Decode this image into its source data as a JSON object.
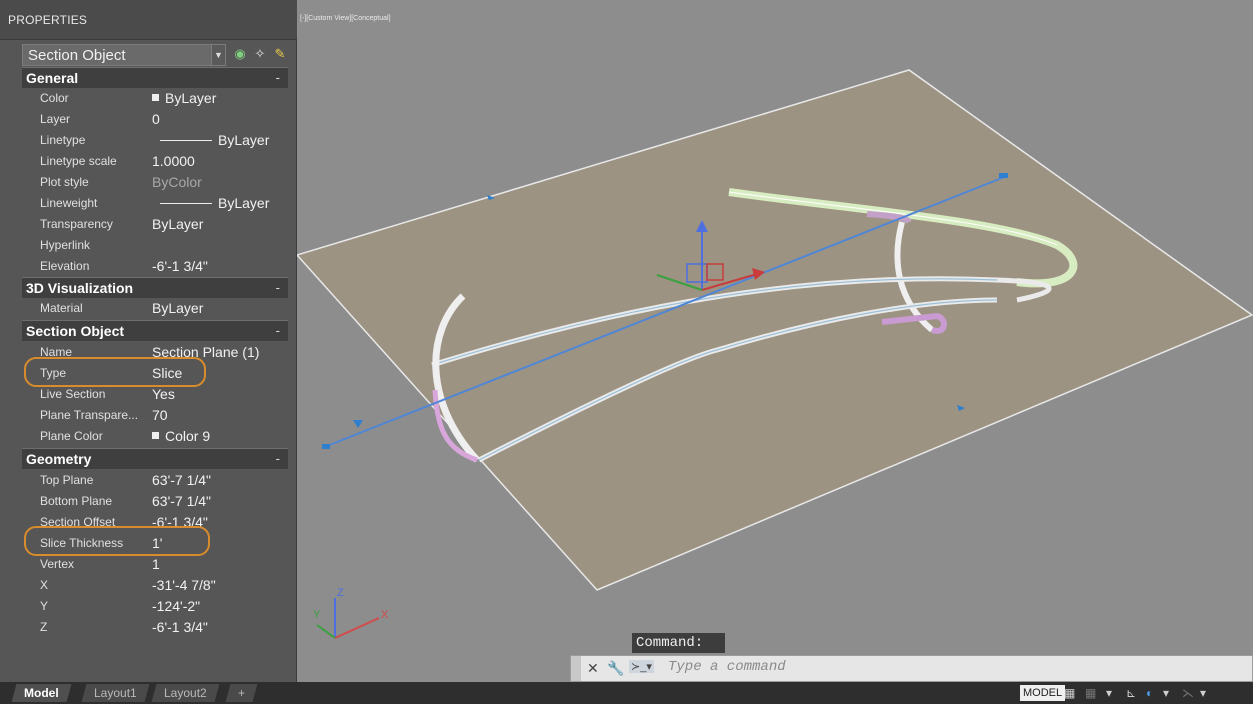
{
  "properties": {
    "title": "PROPERTIES",
    "object_select": "Section Object",
    "sections": {
      "general": {
        "title": "General",
        "toggle": "-",
        "rows": [
          {
            "key": "Color",
            "value": "ByLayer"
          },
          {
            "key": "Layer",
            "value": "0"
          },
          {
            "key": "Linetype",
            "value": "ByLayer"
          },
          {
            "key": "Linetype scale",
            "value": "1.0000"
          },
          {
            "key": "Plot style",
            "value": "ByColor"
          },
          {
            "key": "Lineweight",
            "value": "ByLayer"
          },
          {
            "key": "Transparency",
            "value": "ByLayer"
          },
          {
            "key": "Hyperlink",
            "value": ""
          },
          {
            "key": "Elevation",
            "value": "-6'-1 3/4\""
          }
        ]
      },
      "viz": {
        "title": "3D Visualization",
        "toggle": "-",
        "rows": [
          {
            "key": "Material",
            "value": "ByLayer"
          }
        ]
      },
      "section": {
        "title": "Section Object",
        "toggle": "-",
        "rows": [
          {
            "key": "Name",
            "value": "Section Plane (1)"
          },
          {
            "key": "Type",
            "value": "Slice"
          },
          {
            "key": "Live Section",
            "value": "Yes"
          },
          {
            "key": "Plane Transpare...",
            "value": "70"
          },
          {
            "key": "Plane Color",
            "value": "Color 9"
          }
        ]
      },
      "geometry": {
        "title": "Geometry",
        "toggle": "-",
        "rows": [
          {
            "key": "Top Plane",
            "value": "63'-7 1/4\""
          },
          {
            "key": "Bottom Plane",
            "value": "63'-7 1/4\""
          },
          {
            "key": "Section Offset",
            "value": "-6'-1 3/4\""
          },
          {
            "key": "Slice Thickness",
            "value": "1'"
          },
          {
            "key": "Vertex",
            "value": "1"
          },
          {
            "key": "X",
            "value": "-31'-4 7/8\""
          },
          {
            "key": "Y",
            "value": "-124'-2\""
          },
          {
            "key": "Z",
            "value": "-6'-1 3/4\""
          }
        ]
      }
    }
  },
  "viewport": {
    "label": "[-][Custom View][Conceptual]"
  },
  "command": {
    "label": "Command:",
    "placeholder": "Type a command"
  },
  "tabs": [
    "Model",
    "Layout1",
    "Layout2",
    "+"
  ],
  "status": {
    "model": "MODEL"
  }
}
